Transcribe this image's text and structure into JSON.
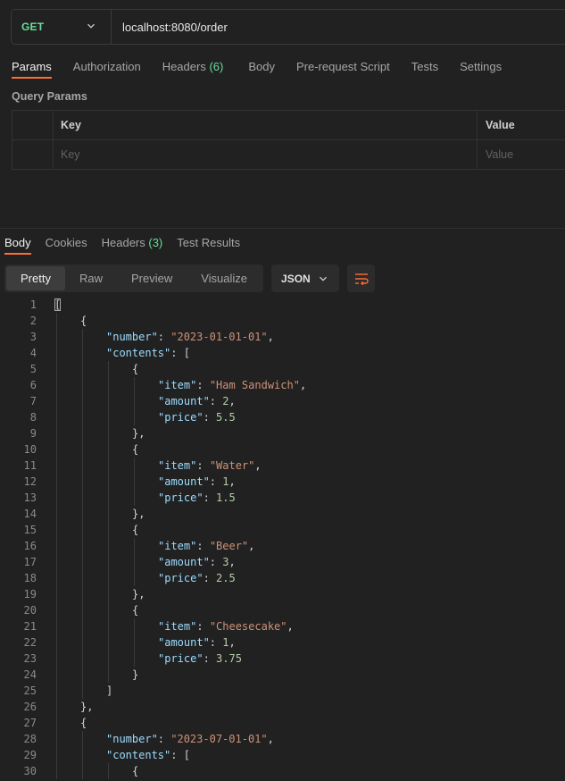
{
  "request": {
    "method": "GET",
    "url": "localhost:8080/order"
  },
  "request_tabs": [
    {
      "label": "Params",
      "count": ""
    },
    {
      "label": "Authorization",
      "count": ""
    },
    {
      "label": "Headers",
      "count": "(6)"
    },
    {
      "label": "Body",
      "count": ""
    },
    {
      "label": "Pre-request Script",
      "count": ""
    },
    {
      "label": "Tests",
      "count": ""
    },
    {
      "label": "Settings",
      "count": ""
    }
  ],
  "query_params": {
    "title": "Query Params",
    "key_header": "Key",
    "value_header": "Value",
    "key_placeholder": "Key",
    "value_placeholder": "Value"
  },
  "response_tabs": [
    {
      "label": "Body",
      "count": ""
    },
    {
      "label": "Cookies",
      "count": ""
    },
    {
      "label": "Headers",
      "count": "(3)"
    },
    {
      "label": "Test Results",
      "count": ""
    }
  ],
  "view_modes": [
    "Pretty",
    "Raw",
    "Preview",
    "Visualize"
  ],
  "format": "JSON",
  "icons": {
    "dropdown": "chevron-down-icon",
    "wrap": "wrap-lines-icon"
  },
  "colors": {
    "accent": "#ff6c37",
    "method": "#6bdd9a",
    "json_key": "#9cdcfe",
    "json_string": "#ce9178",
    "json_number": "#b5cea8"
  },
  "code_lines": [
    {
      "n": "1",
      "d": 0,
      "p": [
        [
          "[",
          "p"
        ]
      ]
    },
    {
      "n": "2",
      "d": 1,
      "p": [
        [
          "{",
          "p"
        ]
      ]
    },
    {
      "n": "3",
      "d": 2,
      "p": [
        [
          "\"number\"",
          "k"
        ],
        [
          ": ",
          "p"
        ],
        [
          "\"2023-01-01-01\"",
          "s"
        ],
        [
          ",",
          "p"
        ]
      ]
    },
    {
      "n": "4",
      "d": 2,
      "p": [
        [
          "\"contents\"",
          "k"
        ],
        [
          ": [",
          "p"
        ]
      ]
    },
    {
      "n": "5",
      "d": 3,
      "p": [
        [
          "{",
          "p"
        ]
      ]
    },
    {
      "n": "6",
      "d": 4,
      "p": [
        [
          "\"item\"",
          "k"
        ],
        [
          ": ",
          "p"
        ],
        [
          "\"Ham Sandwich\"",
          "s"
        ],
        [
          ",",
          "p"
        ]
      ]
    },
    {
      "n": "7",
      "d": 4,
      "p": [
        [
          "\"amount\"",
          "k"
        ],
        [
          ": ",
          "p"
        ],
        [
          "2",
          "n"
        ],
        [
          ",",
          "p"
        ]
      ]
    },
    {
      "n": "8",
      "d": 4,
      "p": [
        [
          "\"price\"",
          "k"
        ],
        [
          ": ",
          "p"
        ],
        [
          "5.5",
          "n"
        ]
      ]
    },
    {
      "n": "9",
      "d": 3,
      "p": [
        [
          "},",
          "p"
        ]
      ]
    },
    {
      "n": "10",
      "d": 3,
      "p": [
        [
          "{",
          "p"
        ]
      ]
    },
    {
      "n": "11",
      "d": 4,
      "p": [
        [
          "\"item\"",
          "k"
        ],
        [
          ": ",
          "p"
        ],
        [
          "\"Water\"",
          "s"
        ],
        [
          ",",
          "p"
        ]
      ]
    },
    {
      "n": "12",
      "d": 4,
      "p": [
        [
          "\"amount\"",
          "k"
        ],
        [
          ": ",
          "p"
        ],
        [
          "1",
          "n"
        ],
        [
          ",",
          "p"
        ]
      ]
    },
    {
      "n": "13",
      "d": 4,
      "p": [
        [
          "\"price\"",
          "k"
        ],
        [
          ": ",
          "p"
        ],
        [
          "1.5",
          "n"
        ]
      ]
    },
    {
      "n": "14",
      "d": 3,
      "p": [
        [
          "},",
          "p"
        ]
      ]
    },
    {
      "n": "15",
      "d": 3,
      "p": [
        [
          "{",
          "p"
        ]
      ]
    },
    {
      "n": "16",
      "d": 4,
      "p": [
        [
          "\"item\"",
          "k"
        ],
        [
          ": ",
          "p"
        ],
        [
          "\"Beer\"",
          "s"
        ],
        [
          ",",
          "p"
        ]
      ]
    },
    {
      "n": "17",
      "d": 4,
      "p": [
        [
          "\"amount\"",
          "k"
        ],
        [
          ": ",
          "p"
        ],
        [
          "3",
          "n"
        ],
        [
          ",",
          "p"
        ]
      ]
    },
    {
      "n": "18",
      "d": 4,
      "p": [
        [
          "\"price\"",
          "k"
        ],
        [
          ": ",
          "p"
        ],
        [
          "2.5",
          "n"
        ]
      ]
    },
    {
      "n": "19",
      "d": 3,
      "p": [
        [
          "},",
          "p"
        ]
      ]
    },
    {
      "n": "20",
      "d": 3,
      "p": [
        [
          "{",
          "p"
        ]
      ]
    },
    {
      "n": "21",
      "d": 4,
      "p": [
        [
          "\"item\"",
          "k"
        ],
        [
          ": ",
          "p"
        ],
        [
          "\"Cheesecake\"",
          "s"
        ],
        [
          ",",
          "p"
        ]
      ]
    },
    {
      "n": "22",
      "d": 4,
      "p": [
        [
          "\"amount\"",
          "k"
        ],
        [
          ": ",
          "p"
        ],
        [
          "1",
          "n"
        ],
        [
          ",",
          "p"
        ]
      ]
    },
    {
      "n": "23",
      "d": 4,
      "p": [
        [
          "\"price\"",
          "k"
        ],
        [
          ": ",
          "p"
        ],
        [
          "3.75",
          "n"
        ]
      ]
    },
    {
      "n": "24",
      "d": 3,
      "p": [
        [
          "}",
          "p"
        ]
      ]
    },
    {
      "n": "25",
      "d": 2,
      "p": [
        [
          "]",
          "p"
        ]
      ]
    },
    {
      "n": "26",
      "d": 1,
      "p": [
        [
          "},",
          "p"
        ]
      ]
    },
    {
      "n": "27",
      "d": 1,
      "p": [
        [
          "{",
          "p"
        ]
      ]
    },
    {
      "n": "28",
      "d": 2,
      "p": [
        [
          "\"number\"",
          "k"
        ],
        [
          ": ",
          "p"
        ],
        [
          "\"2023-07-01-01\"",
          "s"
        ],
        [
          ",",
          "p"
        ]
      ]
    },
    {
      "n": "29",
      "d": 2,
      "p": [
        [
          "\"contents\"",
          "k"
        ],
        [
          ": [",
          "p"
        ]
      ]
    },
    {
      "n": "30",
      "d": 3,
      "p": [
        [
          "{",
          "p"
        ]
      ]
    }
  ]
}
